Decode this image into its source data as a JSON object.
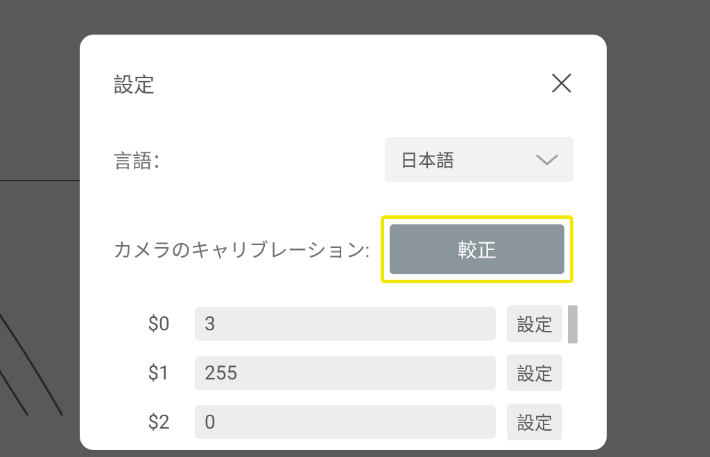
{
  "modal": {
    "title": "設定",
    "language": {
      "label": "言語：",
      "value": "日本語"
    },
    "calibration": {
      "label": "カメラのキャリブレーション:",
      "button": "較正"
    },
    "settings": [
      {
        "key": "$0",
        "value": "3",
        "button": "設定"
      },
      {
        "key": "$1",
        "value": "255",
        "button": "設定"
      },
      {
        "key": "$2",
        "value": "0",
        "button": "設定"
      }
    ]
  }
}
